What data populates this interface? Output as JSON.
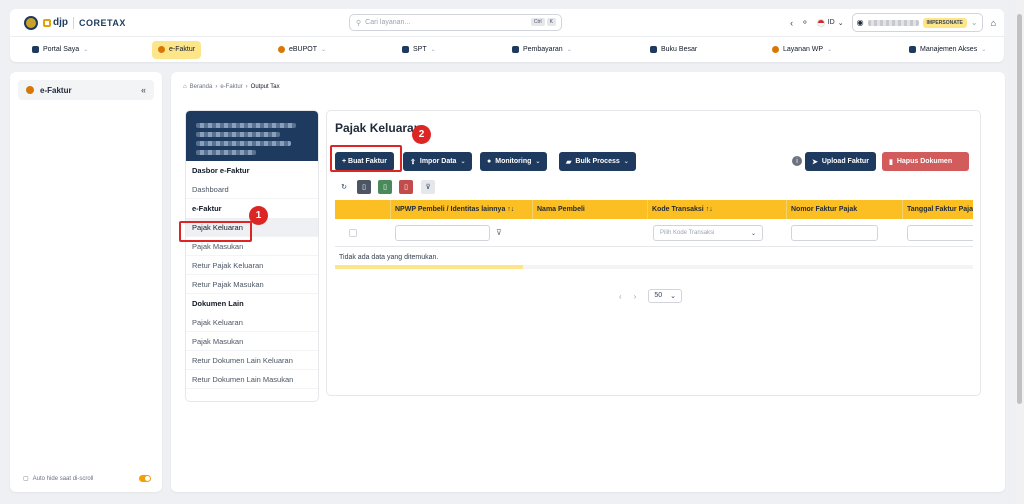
{
  "brand": {
    "djp": "djp",
    "coretax": "CORETAX"
  },
  "search": {
    "placeholder": "Cari layanan...",
    "kbd": [
      "Ctrl",
      "K"
    ]
  },
  "header": {
    "lang": "ID",
    "impersonate": "IMPERSONATE"
  },
  "menu": [
    {
      "label": "Portal Saya",
      "chev": true
    },
    {
      "label": "e-Faktur",
      "chev": false,
      "active": true
    },
    {
      "label": "eBUPOT",
      "chev": true
    },
    {
      "label": "SPT",
      "chev": true
    },
    {
      "label": "Pembayaran",
      "chev": true
    },
    {
      "label": "Buku Besar",
      "chev": false
    },
    {
      "label": "Layanan WP",
      "chev": true
    },
    {
      "label": "Manajemen Akses",
      "chev": true
    }
  ],
  "sidebar": {
    "item": "e-Faktur",
    "collapse": "«",
    "footer": "Auto hide saat di-scroll"
  },
  "breadcrumb": [
    "Beranda",
    "e-Faktur",
    "Output Tax"
  ],
  "subnav": [
    {
      "label": "Dasbor e-Faktur",
      "type": "h"
    },
    {
      "label": "Dashboard",
      "type": "i"
    },
    {
      "label": "e-Faktur",
      "type": "h"
    },
    {
      "label": "Pajak Keluaran",
      "type": "act"
    },
    {
      "label": "Pajak Masukan",
      "type": "i"
    },
    {
      "label": "Retur Pajak Keluaran",
      "type": "i"
    },
    {
      "label": "Retur Pajak Masukan",
      "type": "i"
    },
    {
      "label": "Dokumen Lain",
      "type": "h"
    },
    {
      "label": "Pajak Keluaran",
      "type": "i"
    },
    {
      "label": "Pajak Masukan",
      "type": "i"
    },
    {
      "label": "Retur Dokumen Lain Keluaran",
      "type": "i"
    },
    {
      "label": "Retur Dokumen Lain Masukan",
      "type": "i"
    }
  ],
  "panel": {
    "title": "Pajak Keluaran",
    "buttons": {
      "buat": "+ Buat Faktur",
      "impor": "Impor Data",
      "monitoring": "Monitoring",
      "bulk": "Bulk Process",
      "upload": "Upload Faktur",
      "hapus": "Hapus Dokumen"
    }
  },
  "table": {
    "columns": [
      "NPWP Pembeli / Identitas lainnya ↑↓",
      "Nama Pembeli",
      "Kode Transaksi ↑↓",
      "Nomor Faktur Pajak",
      "Tanggal Faktur Pajak"
    ],
    "kode_placeholder": "Pilih Kode Transaksi",
    "empty": "Tidak ada data yang ditemukan.",
    "page_size": "50"
  },
  "annotations": [
    "1",
    "2"
  ],
  "colors": {
    "navy": "#1e3a5f",
    "yellow": "#fbbf24",
    "red": "#d25b5b",
    "callout": "#dc2626"
  }
}
